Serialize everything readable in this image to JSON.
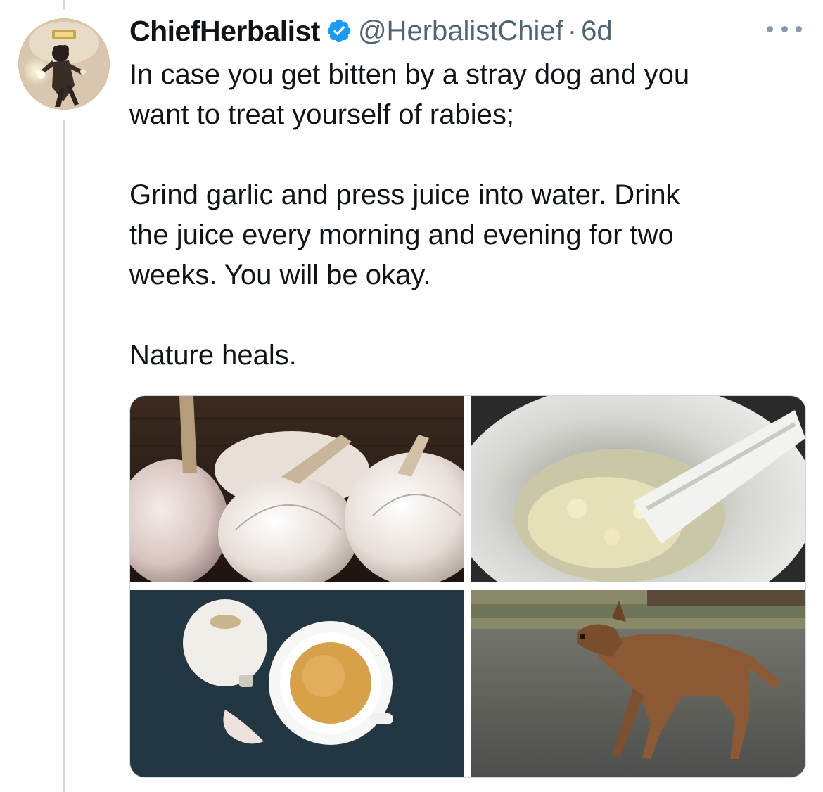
{
  "tweet": {
    "author": {
      "display_name": "ChiefHerbalist",
      "handle": "@HerbalistChief",
      "verified": true
    },
    "separator": "·",
    "timestamp": "6d",
    "text": {
      "p1_line1": "In case you get bitten by a stray dog and you",
      "p1_line2": "want to treat yourself of rabies;",
      "p2_line1": "Grind garlic and press juice into water. Drink",
      "p2_line2": "the juice every morning and evening for two",
      "p2_line3": "weeks. You will be okay.",
      "p3_line1": "Nature heals."
    },
    "media": [
      {
        "description": "garlic bulbs"
      },
      {
        "description": "crushed garlic in mortar and pestle"
      },
      {
        "description": "garlic and cup of tea"
      },
      {
        "description": "stray brown dog walking"
      }
    ]
  },
  "colors": {
    "text_primary": "#0f1419",
    "text_secondary": "#536471",
    "verified_blue": "#1d9bf0",
    "thread_line": "#cfd9de"
  },
  "icons": {
    "verified": "verified-badge-icon",
    "more": "more-options-icon"
  }
}
